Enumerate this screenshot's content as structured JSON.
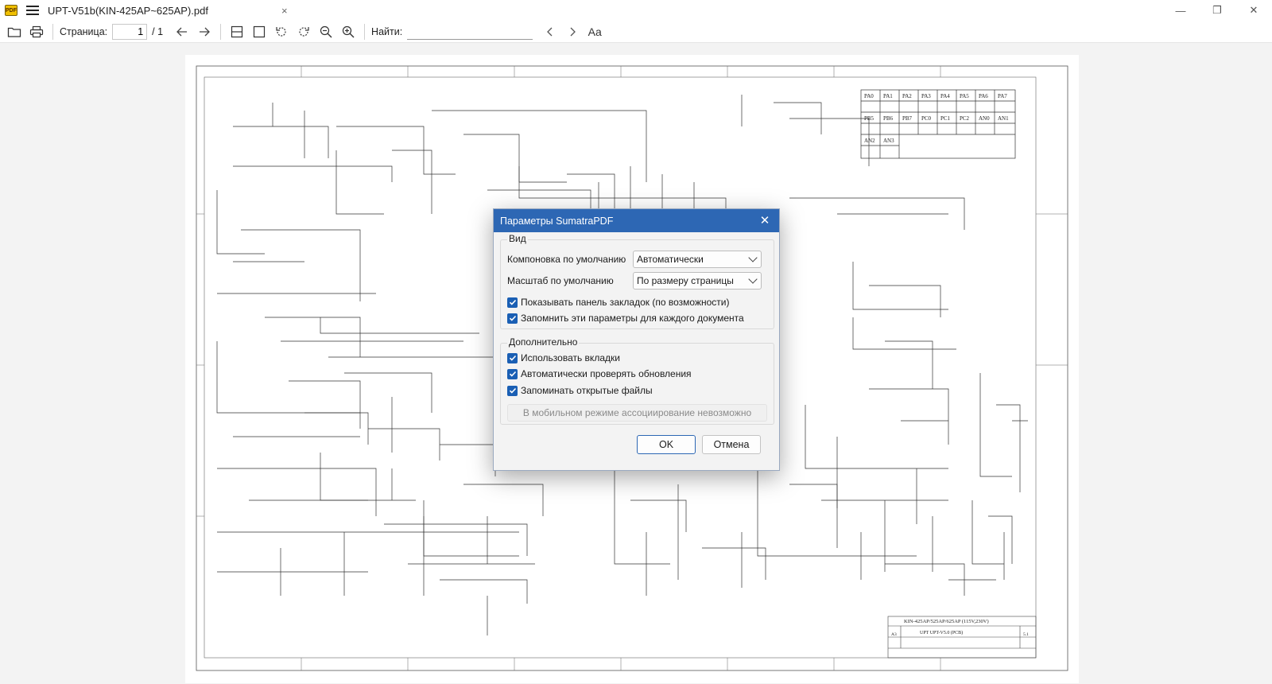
{
  "titlebar": {
    "app_icon_text": "PDF",
    "tab_title": "UPT-V51b(KIN-425AP~625AP).pdf",
    "tab_close": "×",
    "minimize": "—",
    "maximize": "❐",
    "close": "✕"
  },
  "toolbar": {
    "page_label": "Страница:",
    "page_value": "1",
    "page_total": "/ 1",
    "find_label": "Найти:",
    "find_value": "",
    "match_case": "Aa"
  },
  "document": {
    "schematic_title": "KIN-425AP/525AP/625AP (115V,230V)",
    "schematic_subtitle": "UPT   UPT-V5.0 (PCB)",
    "revision": "5.1",
    "size": "A3"
  },
  "dialog": {
    "title": "Параметры SumatraPDF",
    "close": "✕",
    "view_group": {
      "label": "Вид",
      "layout_label": "Компоновка по умолчанию",
      "layout_value": "Автоматически",
      "zoom_label": "Масштаб по умолчанию",
      "zoom_value": "По размеру страницы",
      "show_bookmarks": "Показывать панель закладок (по возможности)",
      "remember_settings": "Запомнить эти параметры для каждого документа"
    },
    "advanced_group": {
      "label": "Дополнительно",
      "use_tabs": "Использовать вкладки",
      "auto_update": "Автоматически проверять обновления",
      "remember_files": "Запоминать открытые файлы",
      "assoc_disabled": "В мобильном режиме ассоциирование невозможно"
    },
    "ok_button": "OK",
    "cancel_button": "Отмена"
  }
}
